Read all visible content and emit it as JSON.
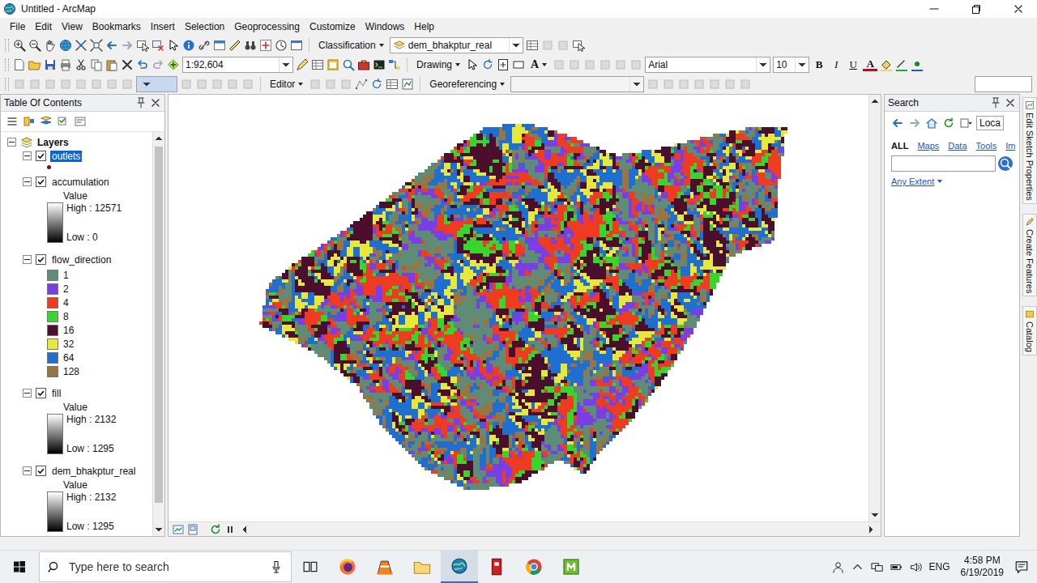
{
  "window": {
    "title": "Untitled - ArcMap"
  },
  "menu": [
    "File",
    "Edit",
    "View",
    "Bookmarks",
    "Insert",
    "Selection",
    "Geoprocessing",
    "Customize",
    "Windows",
    "Help"
  ],
  "toolbar": {
    "classification": "Classification",
    "layer": "dem_bhakptur_real",
    "scale": "1:92,604",
    "drawing": "Drawing",
    "textTool": "A",
    "font": "Arial",
    "fontSize": "10",
    "bold": "B",
    "italic": "I",
    "underline": "U",
    "fontColor": "A",
    "editor": "Editor",
    "georeferencing": "Georeferencing"
  },
  "toc": {
    "title": "Table Of Contents",
    "frame": {
      "name": "Layers",
      "expanded": true
    },
    "layers": [
      {
        "name": "outlets",
        "checked": true,
        "expanded": true,
        "selected": true,
        "kind": "point"
      },
      {
        "name": "accumulation",
        "checked": true,
        "expanded": true,
        "selected": false,
        "kind": "stretched",
        "field": "Value",
        "high": "High : 12571",
        "low": "Low : 0"
      },
      {
        "name": "flow_direction",
        "checked": true,
        "expanded": true,
        "selected": false,
        "kind": "unique",
        "classes": [
          {
            "label": "1",
            "color": "#5e8c76"
          },
          {
            "label": "2",
            "color": "#7a3ee6"
          },
          {
            "label": "4",
            "color": "#ef3b1f"
          },
          {
            "label": "8",
            "color": "#38d62c"
          },
          {
            "label": "16",
            "color": "#4b0f2d"
          },
          {
            "label": "32",
            "color": "#e6e83a"
          },
          {
            "label": "64",
            "color": "#1e6fcf"
          },
          {
            "label": "128",
            "color": "#9a7441"
          }
        ]
      },
      {
        "name": "fill",
        "checked": true,
        "expanded": true,
        "selected": false,
        "kind": "stretched",
        "field": "Value",
        "high": "High : 2132",
        "low": "Low : 1295"
      },
      {
        "name": "dem_bhakptur_real",
        "checked": true,
        "expanded": true,
        "selected": false,
        "kind": "stretched",
        "field": "Value",
        "high": "High : 2132",
        "low": "Low : 1295"
      }
    ]
  },
  "search": {
    "title": "Search",
    "locator": "Loca",
    "tabs": [
      {
        "label": "ALL",
        "selected": true
      },
      {
        "label": "Maps",
        "selected": false
      },
      {
        "label": "Data",
        "selected": false
      },
      {
        "label": "Tools",
        "selected": false
      },
      {
        "label": "Im",
        "selected": false
      }
    ],
    "query": "",
    "extent": "Any Extent"
  },
  "sideTabs": [
    "Edit Sketch Properties",
    "Create Features",
    "Catalog"
  ],
  "taskbar": {
    "searchPlaceholder": "Type here to search",
    "apps": [
      {
        "active": false
      },
      {
        "active": false
      },
      {
        "active": false
      },
      {
        "active": true
      },
      {
        "active": false
      },
      {
        "active": false
      },
      {
        "active": false
      }
    ],
    "language": "ENG",
    "time": "4:58 PM",
    "date": "6/19/2019"
  }
}
